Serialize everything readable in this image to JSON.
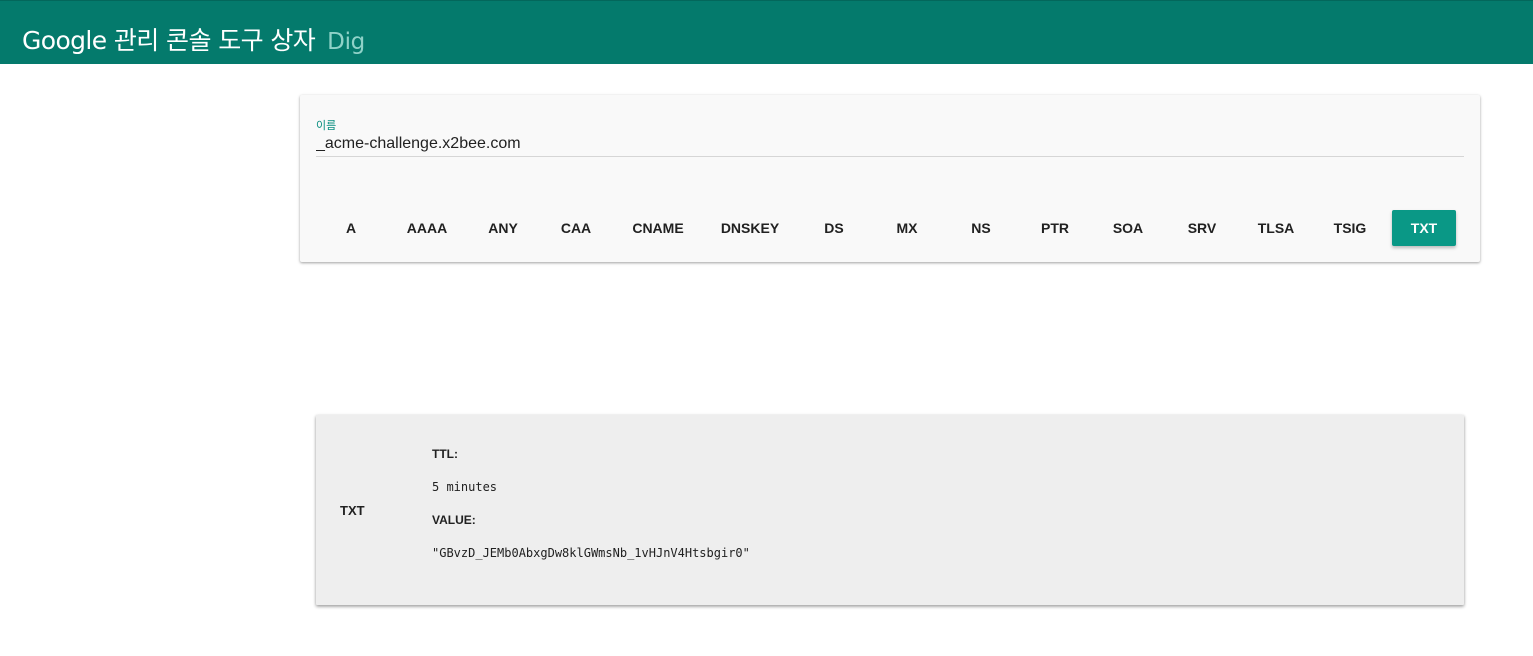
{
  "header": {
    "title": "Google 관리 콘솔 도구 상자",
    "subtitle": "Dig",
    "background_color": "#047a6c"
  },
  "query": {
    "name_label": "이름",
    "name_value": "_acme-challenge.x2bee.com"
  },
  "record_types": {
    "buttons": [
      "A",
      "AAAA",
      "ANY",
      "CAA",
      "CNAME",
      "DNSKEY",
      "DS",
      "MX",
      "NS",
      "PTR",
      "SOA",
      "SRV",
      "TLSA",
      "TSIG",
      "TXT"
    ],
    "selected": "TXT",
    "accent_color": "#0a9886"
  },
  "result": {
    "type": "TXT",
    "ttl_label": "TTL:",
    "ttl_value": "5 minutes",
    "value_label": "VALUE:",
    "value": "\"GBvzD_JEMb0AbxgDw8klGWmsNb_1vHJnV4Htsbgir0\""
  }
}
